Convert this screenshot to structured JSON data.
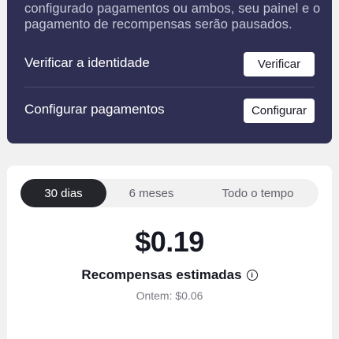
{
  "alert": {
    "message_lines": [
      "configurado pagamentos ou ambos, seu painel e o",
      "pagamento de recompensas serão pausados."
    ],
    "rows": [
      {
        "label": "Verificar a identidade",
        "button": "Verificar"
      },
      {
        "label": "Configurar pagamentos",
        "button": "Configurar"
      }
    ]
  },
  "stats": {
    "tabs": [
      {
        "label": "30 dias",
        "active": true
      },
      {
        "label": "6 meses",
        "active": false
      },
      {
        "label": "Todo o tempo",
        "active": false
      }
    ],
    "amount": "$0.19",
    "amount_label": "Recompensas estimadas",
    "yesterday": "Ontem: $0.06"
  },
  "colors": {
    "alert_bg": "#2f2f53",
    "active_tab_bg": "#25262b",
    "page_bg": "#f1f1f2"
  }
}
